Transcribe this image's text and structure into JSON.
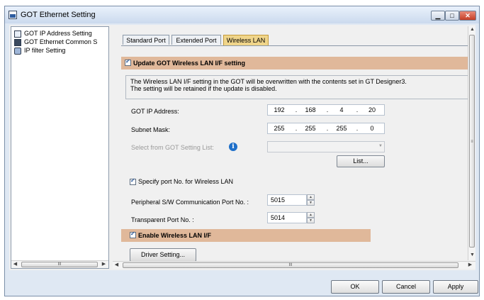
{
  "window": {
    "title": "GOT Ethernet Setting"
  },
  "tree": {
    "items": [
      {
        "label": "GOT IP Address Setting"
      },
      {
        "label": "GOT Ethernet Common S"
      },
      {
        "label": "IP filter Setting"
      }
    ],
    "scroll_thumb": "III"
  },
  "tabs": [
    {
      "label": "Standard Port"
    },
    {
      "label": "Extended Port"
    },
    {
      "label": "Wireless LAN"
    }
  ],
  "wireless": {
    "update_label": "Update GOT Wireless LAN I/F setting",
    "info_line1": "The Wireless LAN I/F setting in the GOT will be overwritten with the contents set in GT Designer3.",
    "info_line2": "The setting will be retained if the update is disabled.",
    "ip_label": "GOT IP Address:",
    "ip": [
      "192",
      "168",
      "4",
      "20"
    ],
    "mask_label": "Subnet Mask:",
    "mask": [
      "255",
      "255",
      "255",
      "0"
    ],
    "select_label": "Select from GOT Setting List:",
    "info_icon": "i",
    "list_button": "List...",
    "specify_port_label": "Specify port No. for Wireless LAN",
    "peripheral_label": "Peripheral S/W Communication Port No. :",
    "peripheral_value": "5015",
    "transparent_label": "Transparent Port No. :",
    "transparent_value": "5014",
    "enable_label": "Enable Wireless LAN I/F",
    "driver_button": "Driver Setting...",
    "scroll_thumb": "III"
  },
  "buttons": {
    "ok": "OK",
    "cancel": "Cancel",
    "apply": "Apply"
  },
  "colors": {
    "section_bar": "#e0b89a",
    "active_tab": "#f0d58a"
  }
}
